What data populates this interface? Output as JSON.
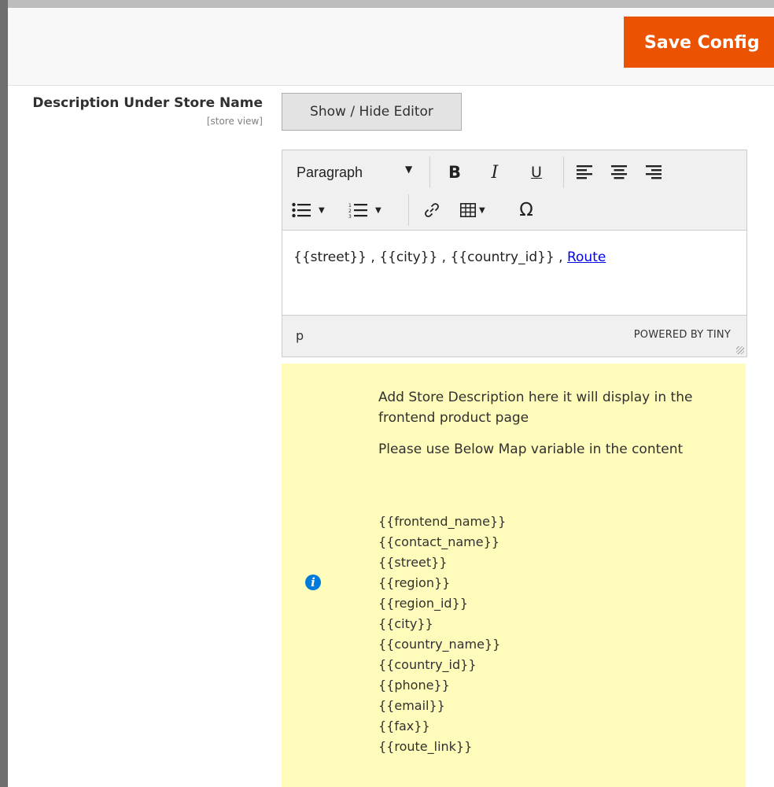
{
  "header": {
    "save_label": "Save Config"
  },
  "field": {
    "label": "Description Under Store Name",
    "scope": "[store view]",
    "toggle_label": "Show / Hide Editor"
  },
  "editor": {
    "format_select": "Paragraph",
    "toolbar": {
      "bold": "B",
      "italic": "I",
      "underline": "U",
      "special_char": "Ω"
    },
    "content_prefix": "{{street}} , {{city}} , {{country_id}} , ",
    "content_link": "Route",
    "status_path": "p",
    "powered_by": "POWERED BY TINY"
  },
  "note": {
    "line1": "Add Store Description here it will display in the frontend product page",
    "line2": "Please use Below Map variable in the content",
    "variables": [
      "{{frontend_name}}",
      "{{contact_name}}",
      "{{street}}",
      "{{region}}",
      "{{region_id}}",
      "{{city}}",
      "{{country_name}}",
      "{{country_id}}",
      "{{phone}}",
      "{{email}}",
      "{{fax}}",
      "{{route_link}}"
    ]
  },
  "colors": {
    "accent": "#eb5202",
    "note_bg": "#fffbbb",
    "info_icon": "#007bdb",
    "link": "#0000ee"
  }
}
